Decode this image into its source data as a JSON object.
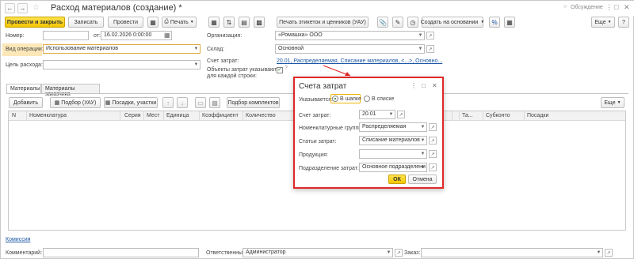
{
  "window": {
    "title": "Расход материалов (создание) *",
    "discussion_label": "Обсуждение"
  },
  "toolbar": {
    "post_close": "Провести и закрыть",
    "save": "Записать",
    "post": "Провести",
    "print": "Печать",
    "print_labels": "Печать этикеток и ценников (УАУ)",
    "create_based": "Создать на основании",
    "more": "Еще"
  },
  "header": {
    "number_label": "Номер:",
    "number_value": "",
    "from_label": "от:",
    "date_value": "16.02.2026  0:00:00",
    "operation_label": "Вид операции:",
    "operation_value": "Использование материалов",
    "purpose_label": "Цель расхода:",
    "purpose_value": "",
    "org_label": "Организация:",
    "org_value": "«Ромашка» ООО",
    "warehouse_label": "Склад:",
    "warehouse_value": "Основной",
    "cost_account_label": "Счет затрат:",
    "cost_account_link": "20.01, Распределяемая, Списание материалов, <...>, Основно...",
    "objects_label_line1": "Объекты затрат указываются",
    "objects_label_line2": "для каждой строки:"
  },
  "tabs": {
    "materials": "Материалы",
    "customer_materials": "Материалы заказчика"
  },
  "table_toolbar": {
    "add": "Добавить",
    "pick": "Подбор (УАУ)",
    "batches": "Посадки, участки",
    "kit_pick": "Подбор комплектов",
    "more": "Еще"
  },
  "grid": {
    "columns": [
      "N",
      "Номенклатура",
      "Серия",
      "Мест",
      "Единица",
      "Коэффициент",
      "Количество",
      "Та...",
      "Субконто",
      "Посадки"
    ]
  },
  "dialog": {
    "title": "Счета затрат",
    "specified_label": "Указывается:",
    "opt_header": "В шапке",
    "opt_list": "В списке",
    "account_label": "Счет затрат:",
    "account_value": "20.01",
    "nom_groups_label": "Номенклатурные группы:",
    "nom_groups_value": "Распределяемая",
    "cost_items_label": "Статьи затрат:",
    "cost_items_value": "Списание материалов",
    "products_label": "Продукция:",
    "products_value": "",
    "department_label": "Подразделение затрат:",
    "department_value": "Основное подразделени",
    "ok": "ОК",
    "cancel": "Отмена"
  },
  "footer": {
    "commission_link": "Комиссия",
    "comment_label": "Комментарий:",
    "comment_value": "",
    "responsible_label": "Ответственный:",
    "responsible_value": "Администратор",
    "order_label": "Заказ:",
    "order_value": ""
  },
  "icons": {
    "back": "arrow-left-icon",
    "forward": "arrow-right-icon",
    "star": "star-icon",
    "close": "close-icon",
    "more_menu": "kebab-icon",
    "maximize": "maximize-icon",
    "open": "link-icon",
    "dropdown": "chevron-down-icon"
  }
}
